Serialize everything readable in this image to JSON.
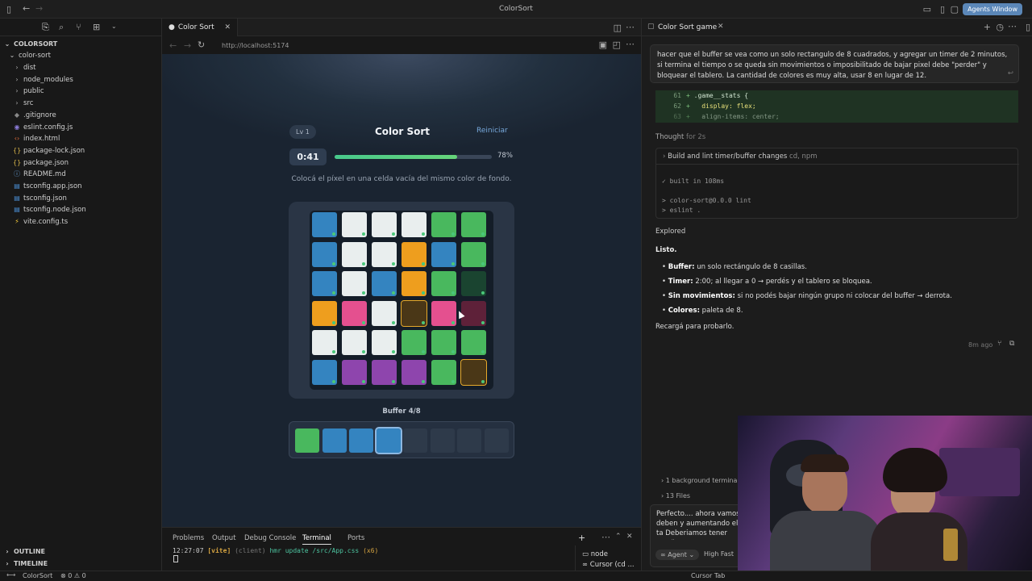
{
  "window": {
    "title": "ColorSort",
    "agents_button": "Agents Window"
  },
  "sidebar": {
    "root": "COLORSORT",
    "folder": "color-sort",
    "items": [
      {
        "label": "dist",
        "kind": "folder"
      },
      {
        "label": "node_modules",
        "kind": "folder"
      },
      {
        "label": "public",
        "kind": "folder"
      },
      {
        "label": "src",
        "kind": "folder"
      },
      {
        "label": ".gitignore",
        "kind": "gitignore"
      },
      {
        "label": "eslint.config.js",
        "kind": "eslint"
      },
      {
        "label": "index.html",
        "kind": "html"
      },
      {
        "label": "package-lock.json",
        "kind": "json"
      },
      {
        "label": "package.json",
        "kind": "json"
      },
      {
        "label": "README.md",
        "kind": "md"
      },
      {
        "label": "tsconfig.app.json",
        "kind": "ts"
      },
      {
        "label": "tsconfig.json",
        "kind": "ts"
      },
      {
        "label": "tsconfig.node.json",
        "kind": "ts"
      },
      {
        "label": "vite.config.ts",
        "kind": "vite"
      }
    ],
    "outline": "OUTLINE",
    "timeline": "TIMELINE"
  },
  "editor": {
    "tab_label": "Color Sort",
    "url": "http://localhost:5174"
  },
  "game": {
    "level": "Lv 1",
    "title": "Color Sort",
    "restart": "Reiniciar",
    "timer": "0:41",
    "progress": 0.78,
    "progress_label": "78%",
    "instruction": "Colocá el píxel en una celda vacía del mismo color de fondo.",
    "colors": {
      "B": "#3484c0",
      "W": "#e9eeee",
      "G": "#49b85e",
      "O": "#ee9e1e",
      "P": "#e4508f",
      "V": "#8e45ad",
      "DG": "#1a4430",
      "BR": "#4a3717",
      "M": "#5e2139"
    },
    "grid": [
      [
        "B",
        "W",
        "W",
        "W",
        "G",
        "G"
      ],
      [
        "B",
        "W",
        "W",
        "O",
        "B",
        "G"
      ],
      [
        "B",
        "W",
        "B",
        "O",
        "G",
        "DG"
      ],
      [
        "O",
        "P",
        "W",
        "BR",
        "P",
        "M"
      ],
      [
        "W",
        "W",
        "W",
        "G",
        "G",
        "G"
      ],
      [
        "B",
        "V",
        "V",
        "V",
        "G",
        "BR"
      ]
    ],
    "highlighted": [
      [
        3,
        3
      ],
      [
        5,
        5
      ]
    ],
    "buffer_label": "Buffer 4/8",
    "buffer": [
      "G",
      "B",
      "B",
      "B",
      "",
      "",
      "",
      ""
    ],
    "buffer_selected": 3
  },
  "panel": {
    "tabs": [
      "Problems",
      "Output",
      "Debug Console",
      "Terminal",
      "Ports"
    ],
    "active_tab": "Terminal",
    "terminal_time": "12:27:07",
    "terminal_tag": "[vite]",
    "terminal_client": "(client)",
    "terminal_msg": "hmr update /src/App.css",
    "terminal_count": "(x6)",
    "terminals": [
      "node",
      "Cursor (cd ..."
    ]
  },
  "statusbar": {
    "project": "ColorSort",
    "errors": "0",
    "warnings": "0",
    "cursor_tab": "Cursor Tab"
  },
  "chat": {
    "title": "Color Sort game",
    "user_message": "hacer que el buffer se vea como un solo rectangulo de 8 cuadrados, y agregar un timer de 2 minutos, si termina el tiempo o se queda sin movimientos o imposibilitado de bajar pixel debe \"perder\" y bloquear el tablero. La cantidad de colores es muy alta, usar 8 en lugar de 12.",
    "code": [
      {
        "n": "61",
        "t": ".game__stats {"
      },
      {
        "n": "62",
        "t": "  display: flex;"
      },
      {
        "n": "63",
        "t": "  align-items: center;"
      }
    ],
    "thought": "Thought",
    "thought_time": "for 2s",
    "build_title": "Build and lint timer/buffer changes",
    "build_meta": "cd, npm",
    "term": [
      "✓ built in 108ms",
      "> color-sort@0.0.0 lint",
      "> eslint ."
    ],
    "explored": "Explored",
    "listo": "Listo.",
    "bullets": [
      {
        "b": "Buffer:",
        "t": " un solo rectángulo de 8 casillas."
      },
      {
        "b": "Timer:",
        "t": " 2:00; al llegar a 0 → perdés y el tablero se bloquea."
      },
      {
        "b": "Sin movimientos:",
        "t": " si no podés bajar ningún grupo ni colocar del buffer → derrota."
      },
      {
        "b": "Colores:",
        "t": " paleta de 8."
      }
    ],
    "recarga": "Recargá para probarlo.",
    "ago": "8m ago",
    "bg_terminal": "1 background terminal",
    "files": "13 Files",
    "composer_text": "Perfecto.... ahora vamos deben y aumentando el ta Deberiamos tener una \"e",
    "agent_label": "Agent",
    "model_label": "High Fast"
  }
}
